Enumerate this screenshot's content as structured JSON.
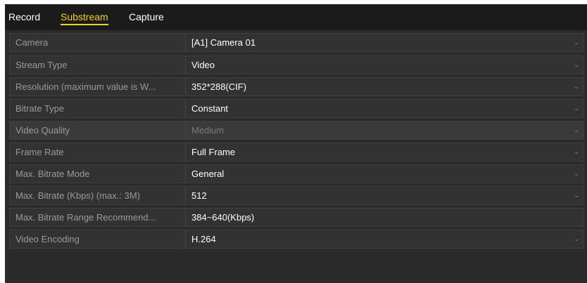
{
  "tabs": [
    {
      "label": "Record"
    },
    {
      "label": "Substream"
    },
    {
      "label": "Capture"
    }
  ],
  "active_tab": "Substream",
  "rows": [
    {
      "label": "Camera",
      "value": "[A1] Camera 01"
    },
    {
      "label": "Stream Type",
      "value": "Video"
    },
    {
      "label": "Resolution (maximum value is W...",
      "value": "352*288(CIF)"
    },
    {
      "label": "Bitrate Type",
      "value": "Constant"
    },
    {
      "label": "Video Quality",
      "value": "Medium"
    },
    {
      "label": "Frame Rate",
      "value": "Full Frame"
    },
    {
      "label": "Max. Bitrate Mode",
      "value": "General"
    },
    {
      "label": "Max. Bitrate (Kbps) (max.: 3M)",
      "value": "512"
    },
    {
      "label": "Max. Bitrate Range Recommend...",
      "value": "384~640(Kbps)"
    },
    {
      "label": "Video Encoding",
      "value": "H.264"
    }
  ],
  "icons": {
    "dropdown": "chevron-down-icon"
  },
  "colors": {
    "accent": "#f3d11d",
    "panel_bg": "#2b2b2b",
    "label_text": "#9a9a9a",
    "value_text": "#ffffff",
    "disabled_text": "#7a7a7a"
  }
}
